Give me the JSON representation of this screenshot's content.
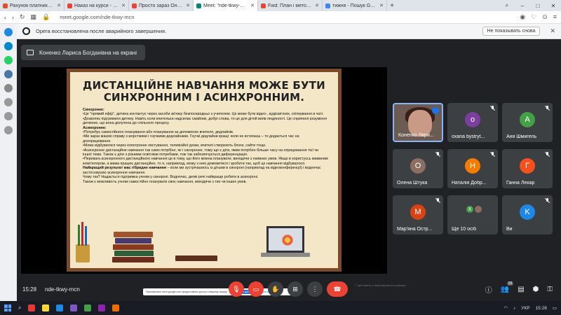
{
  "browser": {
    "tabs": [
      {
        "title": "Рахунок платника - #209!",
        "color": "#e34c26",
        "active": false
      },
      {
        "title": "Наказ на курси - kursi.kom",
        "color": "#ea4335",
        "active": false
      },
      {
        "title": "Просто зараз Онлайн Ле",
        "color": "#ea4335",
        "active": false
      },
      {
        "title": "Meet: \"nde-tkwy-mcn\"",
        "color": "#00897b",
        "active": true
      },
      {
        "title": "Fwd: План і методичні на",
        "color": "#ea4335",
        "active": false
      },
      {
        "title": "тижня - Пошук Google",
        "color": "#4285f4",
        "active": false
      }
    ],
    "url": "meet.google.com/nde-tkwy-mcn",
    "restore_message": "Opera восстановлена после аварийного завершения.",
    "restore_button": "Не показывать снова"
  },
  "meet": {
    "presenter_label": "Коненко Лариса Богданівна на екрані",
    "time": "15:28",
    "meeting_code": "nde-tkwy-mcn",
    "participants_count": "19",
    "prompt": {
      "text": "Приложению meet.google.com предоставлен доступ к вашему экрану.",
      "allow": "Закрыть доступ",
      "hide": "Скрыть"
    },
    "stop_note": "Г, щоб вийти з повноекранного режиму"
  },
  "slide": {
    "title_line1": "ДИСТАНЦІЙНЕ НАВЧАННЯ МОЖЕ БУТИ",
    "title_line2": "СИНХРОННИМ І АСИНХРОННИМ.",
    "sync_heading": "Синхронне:",
    "sync_items": [
      "•Це \"прямий ефір\", дитина контактує через засоби зв'язку безпосередньо з учителем. Це може бути відео-, аудіозв'язок, спілкування в чаті.",
      "•Дозволяє підтримати дитину. Навіть коли вчителька надсилає смайлик, добрі слова, то це для дітей вияв людяності. Це сприяння розуміння дитиною, що вона долучена до спільного процесу."
    ],
    "async_heading": "Асинхронне:",
    "async_items": [
      "•Потребує самостійного планування або планування за допомогою вчителя, дедлайнів.",
      "•Ми зараз маємо справу з жорсткими і гнучкими дедлайнами. Гнучкі дедлайни кращі: коли не встигаєш – то додається час на доопрацювання.",
      "•Може відбуватися через електронне листування, телевізійні уроки, вчителі створюють блоги, сайти тощо.",
      "•Асинхронне дистанційне навчання так само потрібне, як і синхронне, тому що є діти, яким потрібно більше часу на опрацювання тієї чи іншої теми. Також є діти з різними освітніми потребами, тож так забезпечується диференціація.",
      "•Перевага асинхронного дистанційного навчання це в тому, що його можна планувати, виходячи з наявних умов. Якщо в користуєсь маминим комп'ютером, а мама працює дистанційно, то я, наприклад, можу з нею домовитися і зробити так, щоб це навчання відбувалося."
    ],
    "hybrid_heading": "Найкращий результат має гібридне навчання",
    "hybrid_text": " – коли ми зустрічаємось із дітьми в синхроні (наприклад на відеоконференції) і водночас застосовуємо асинхронне навчання.",
    "hybrid_q_heading": "Найкращий результат має гібридне навчання",
    "last_lines": [
      "Чому так? Надається підтримка учням у синхроні. Водночас, деякі речі найкраще робити в асинхроні.",
      "Також є можливість учням самостійно планувати своє навчання, виходячи з тих чи інших умов."
    ],
    "laptop_text": "Мы вчимося!"
  },
  "participants": [
    {
      "name": "Коненко Лари...",
      "initial": "",
      "color": "#6b5b52",
      "self": true
    },
    {
      "name": "oxana bystryt...",
      "initial": "o",
      "color": "#7b3fa0",
      "self": false
    },
    {
      "name": "Аня Шмигель",
      "initial": "А",
      "color": "#43a047",
      "self": false
    },
    {
      "name": "Олена Штука",
      "initial": "О",
      "color": "#8d6e63",
      "self": false
    },
    {
      "name": "Наталія Добр...",
      "initial": "Н",
      "color": "#f57c00",
      "self": false
    },
    {
      "name": "Ганна Лекар",
      "initial": "Г",
      "color": "#f4511e",
      "self": false
    },
    {
      "name": "Мар'яна Остр...",
      "initial": "М",
      "color": "#d84315",
      "self": false
    },
    {
      "name": "Ще 10 осіб",
      "initial": "Х",
      "color": "#43a047",
      "self": false
    },
    {
      "name": "Ви",
      "initial": "K",
      "color": "#1e88e5",
      "self": false
    }
  ],
  "taskbar": {
    "lang": "УКР",
    "clock": "15:28"
  }
}
